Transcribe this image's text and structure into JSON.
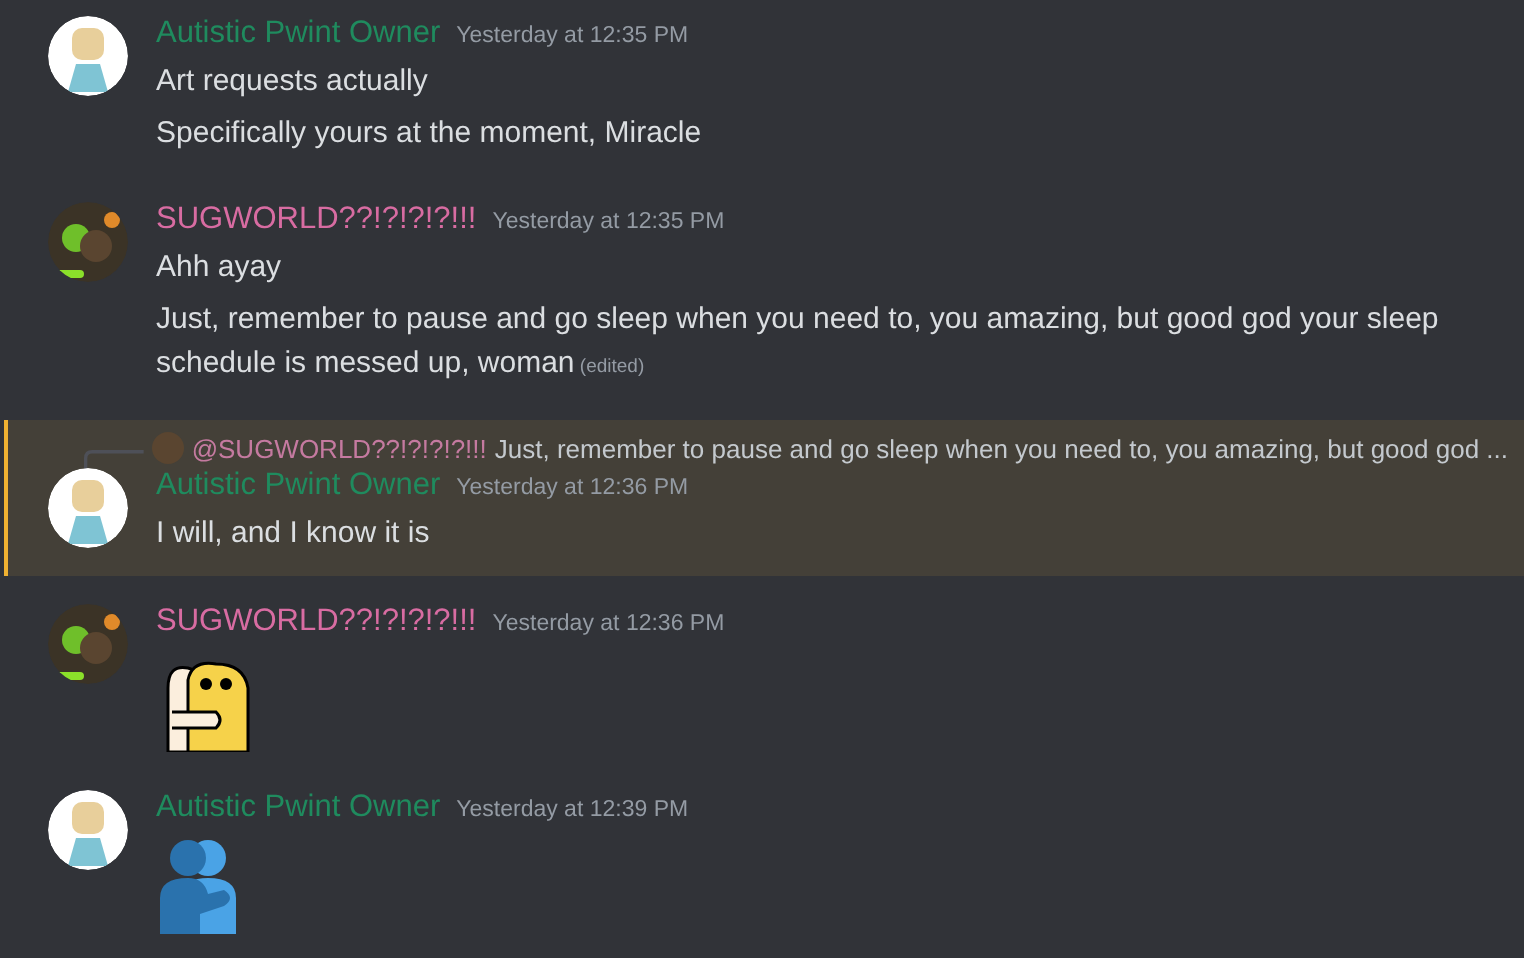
{
  "messages": [
    {
      "author": "Autistic Pwint Owner",
      "color": "#1f8b5e",
      "avatar": {
        "kind": "light"
      },
      "timestamp": "Yesterday at 12:35 PM",
      "highlighted": false,
      "lines": [
        {
          "text": "Art requests actually",
          "edited": false
        },
        {
          "text": "Specifically yours at the moment, Miracle",
          "edited": false
        }
      ]
    },
    {
      "author": "SUGWORLD??!?!?!?!!!",
      "color": "#d86ca2",
      "avatar": {
        "kind": "dark"
      },
      "timestamp": "Yesterday at 12:35 PM",
      "highlighted": false,
      "lines": [
        {
          "text": "Ahh ayay",
          "edited": false
        },
        {
          "text": "Just, remember to pause and go sleep when you need to, you amazing, but good god your sleep schedule is messed up, woman",
          "edited": true,
          "edited_label": "(edited)"
        }
      ]
    },
    {
      "author": "Autistic Pwint Owner",
      "color": "#1f8b5e",
      "avatar": {
        "kind": "light"
      },
      "timestamp": "Yesterday at 12:36 PM",
      "highlighted": true,
      "reply": {
        "mention": "@SUGWORLD??!?!?!?!!!",
        "color": "#c57aa0",
        "text": "Just, remember to pause and go sleep when you need to, you amazing, but good god ..."
      },
      "lines": [
        {
          "text": "I will, and I know it is",
          "edited": false
        }
      ]
    },
    {
      "author": "SUGWORLD??!?!?!?!!!",
      "color": "#d86ca2",
      "avatar": {
        "kind": "dark"
      },
      "timestamp": "Yesterday at 12:36 PM",
      "highlighted": false,
      "attachment": {
        "kind": "sticker"
      }
    },
    {
      "author": "Autistic Pwint Owner",
      "color": "#1f8b5e",
      "avatar": {
        "kind": "light"
      },
      "timestamp": "Yesterday at 12:39 PM",
      "highlighted": false,
      "attachment": {
        "kind": "emoji"
      }
    }
  ]
}
